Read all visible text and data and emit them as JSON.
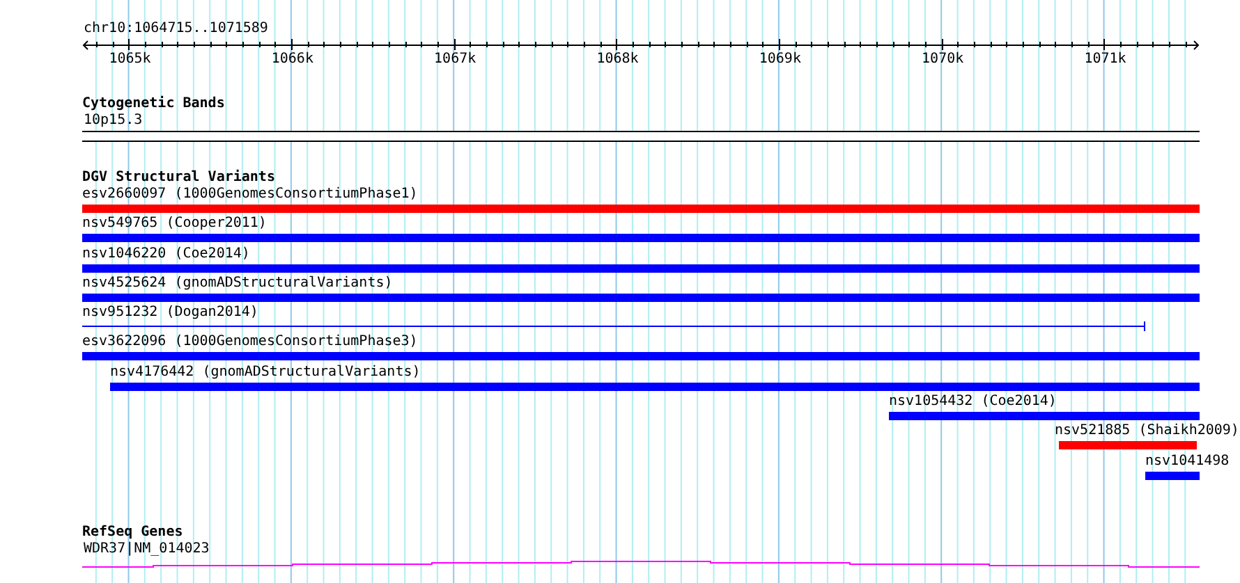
{
  "ruler": {
    "location": "chr10:1064715..1071589",
    "ticks": [
      "1065k",
      "1066k",
      "1067k",
      "1068k",
      "1069k",
      "1070k",
      "1071k"
    ]
  },
  "cytogenetic_bands": {
    "title": "Cytogenetic Bands",
    "bands": [
      {
        "name": "10p15.3"
      }
    ]
  },
  "dgv": {
    "title": "DGV Structural Variants",
    "features": [
      {
        "label": "esv2660097 (1000GenomesConsortiumPhase1)",
        "kind": "bar",
        "color": "#ff0000"
      },
      {
        "label": "nsv549765 (Cooper2011)",
        "kind": "bar",
        "color": "#0000ff"
      },
      {
        "label": "nsv1046220 (Coe2014)",
        "kind": "bar",
        "color": "#0000ff"
      },
      {
        "label": "nsv4525624 (gnomADStructuralVariants)",
        "kind": "bar",
        "color": "#0000ff"
      },
      {
        "label": "nsv951232 (Dogan2014)",
        "kind": "line",
        "color": "#0000ff"
      },
      {
        "label": "esv3622096 (1000GenomesConsortiumPhase3)",
        "kind": "bar",
        "color": "#0000ff"
      },
      {
        "label": "nsv4176442 (gnomADStructuralVariants)",
        "kind": "bar",
        "color": "#0000ff"
      },
      {
        "label": "nsv1054432 (Coe2014)",
        "kind": "bar",
        "color": "#0000ff"
      },
      {
        "label": "nsv521885 (Shaikh2009)",
        "kind": "bar",
        "color": "#ff0000"
      },
      {
        "label": "nsv1041498",
        "kind": "bar",
        "color": "#0000ff"
      }
    ]
  },
  "refseq": {
    "title": "RefSeq Genes",
    "genes": [
      {
        "name": "WDR37|NM_014023"
      }
    ]
  }
}
